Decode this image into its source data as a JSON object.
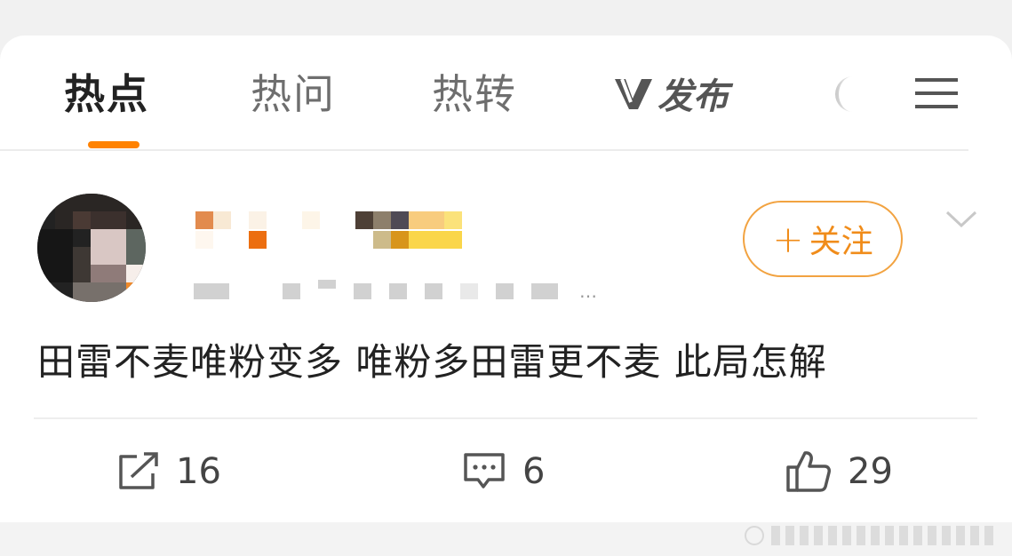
{
  "tabs": [
    {
      "label": "热点",
      "active": true
    },
    {
      "label": "热问",
      "active": false
    },
    {
      "label": "热转",
      "active": false
    }
  ],
  "brand": {
    "logo_text": "发布",
    "icon": "v-logo-icon"
  },
  "header_icons": [
    "moon-icon",
    "menu-icon"
  ],
  "post": {
    "meta_tail": "…",
    "follow_label": "关注",
    "follow_plus": "+",
    "text": "田雷不麦唯粉变多 唯粉多田雷更不麦 此局怎解"
  },
  "actions": {
    "repost": {
      "icon": "share-icon",
      "count": "16"
    },
    "comment": {
      "icon": "comment-icon",
      "count": "6"
    },
    "like": {
      "icon": "thumbs-up-icon",
      "count": "29"
    }
  },
  "colors": {
    "accent": "#ff8200",
    "follow_border": "#f2a341",
    "follow_text": "#f08c1a",
    "text_primary": "#222222",
    "text_secondary": "#6e6e6e"
  }
}
